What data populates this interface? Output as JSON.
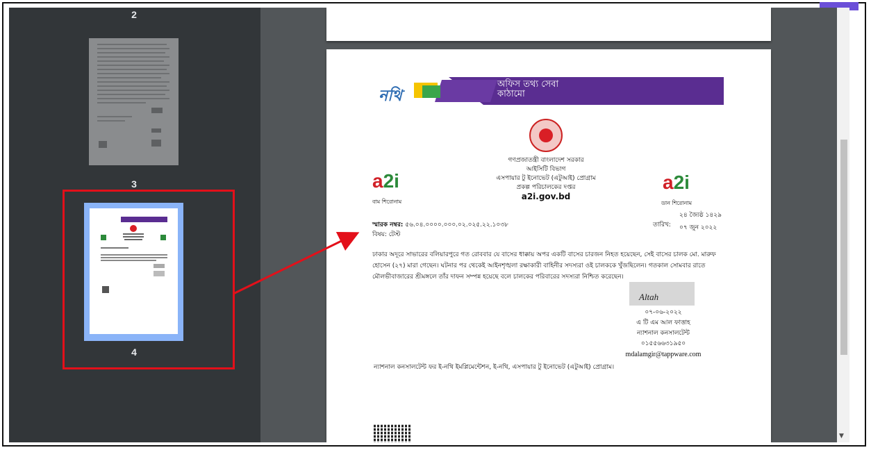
{
  "sidebar": {
    "page_labels": [
      "2",
      "3",
      "4"
    ],
    "selected_page": "4"
  },
  "document": {
    "banner": {
      "logo_text": "নথি",
      "tagline": "অফিস তথ্য সেবা কাঠামো"
    },
    "gov_header": [
      "গণপ্রজাতন্ত্রী বাংলাদেশ সরকার",
      "আইসিটি বিভাগ",
      "এসপায়ার টু ইনোভেট (এটুআই) প্রোগ্রাম",
      "প্রকল্প পরিচালকের দপ্তর"
    ],
    "gov_url": "a2i.gov.bd",
    "left_logo": {
      "text_a": "a",
      "text_2i": "2i",
      "caption": "বাম শিরোনাম"
    },
    "right_logo": {
      "text_a": "a",
      "text_2i": "2i",
      "caption": "ডান শিরোনাম"
    },
    "memo_label": "স্মারক নম্বর:",
    "memo_number": "৫৬.০৪.০০০০.০০০.০২.০২৫.২২.১০৩৮",
    "subject": "বিষয়: টেস্ট",
    "date_label": "তারিখ:",
    "date_bn": "২৪ জ্যৈষ্ঠ ১৪২৯",
    "date_en_bn": "০৭ জুন ২০২২",
    "body": "ঢাকার অদূরে সাভারের বলিয়ারপুরে গত রোববার যে বাসের ধাক্কায় অপর একটি বাসের চারজন নিহত হয়েছেন, সেই বাসের চালক মো. মারুফ হোসেন (২৭) মারা গেছেন। ঘটনার পর থেকেই আইনশৃঙ্খলা রক্ষাকারী বাহিনীর সদস্যরা ওই চালককে খুঁজছিলেন। গতকাল সোমবার রাতে মৌলভীবাজারের শ্রীমঙ্গলে তাঁর দাফন সম্পন্ন হয়েছে বলে চালকের পরিবারের সদস্যরা নিশ্চিত করেছেন।",
    "signature": {
      "scribble": "Altah",
      "date": "০৭-০৬-২০২২",
      "name": "এ টি এম আল ফাত্তাহ",
      "designation": "ন্যাশনাল কনসালটেন্ট",
      "phone": "০১৫৫৬৬৩১৯৫০",
      "email": "mdalamgir@tappware.com"
    },
    "footer": "ন্যাশনাল কনসালটেন্ট ফর ই-নথি ইমপ্লিমেন্টেশন, ই-নথি, এসপায়ার টু ইনোভেট (এটুআই) প্রোগ্রাম।"
  },
  "colors": {
    "sidebar_bg": "#323639",
    "viewer_bg": "#525659",
    "highlight": "#e3101a",
    "selected_thumb": "#8ab4f8",
    "banner_purple": "#5a2d91"
  }
}
